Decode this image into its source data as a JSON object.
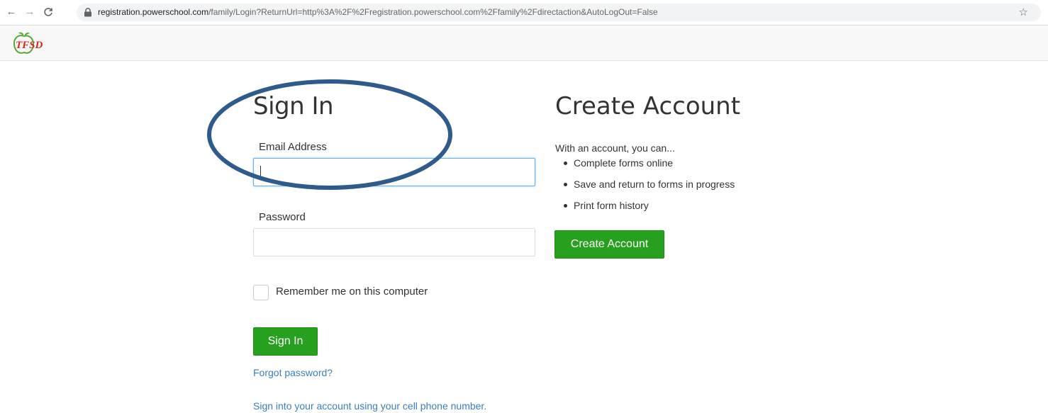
{
  "browser": {
    "url_host": "registration.powerschool.com",
    "url_path": "/family/Login?ReturnUrl=http%3A%2F%2Fregistration.powerschool.com%2Ffamily%2Fdirectaction&AutoLogOut=False",
    "back_icon": "arrow-left",
    "forward_icon": "arrow-right",
    "reload_icon": "reload",
    "bookmark_icon": "star"
  },
  "header": {
    "logo_text": "TFSD"
  },
  "signin": {
    "title": "Sign In",
    "email_label": "Email Address",
    "email_value": "",
    "password_label": "Password",
    "password_value": "",
    "remember_label": "Remember me on this computer",
    "remember_checked": false,
    "submit_label": "Sign In",
    "forgot_link": "Forgot password?",
    "phone_link": "Sign into your account using your cell phone number."
  },
  "create_account": {
    "title": "Create Account",
    "intro": "With an account, you can...",
    "benefits": [
      "Complete forms online",
      "Save and return to forms in progress",
      "Print form history"
    ],
    "button_label": "Create Account"
  },
  "colors": {
    "primary_green": "#28a01f",
    "link_blue": "#3b7fc4",
    "focus_border": "#66afe9",
    "annotation": "#2e5a8c"
  }
}
